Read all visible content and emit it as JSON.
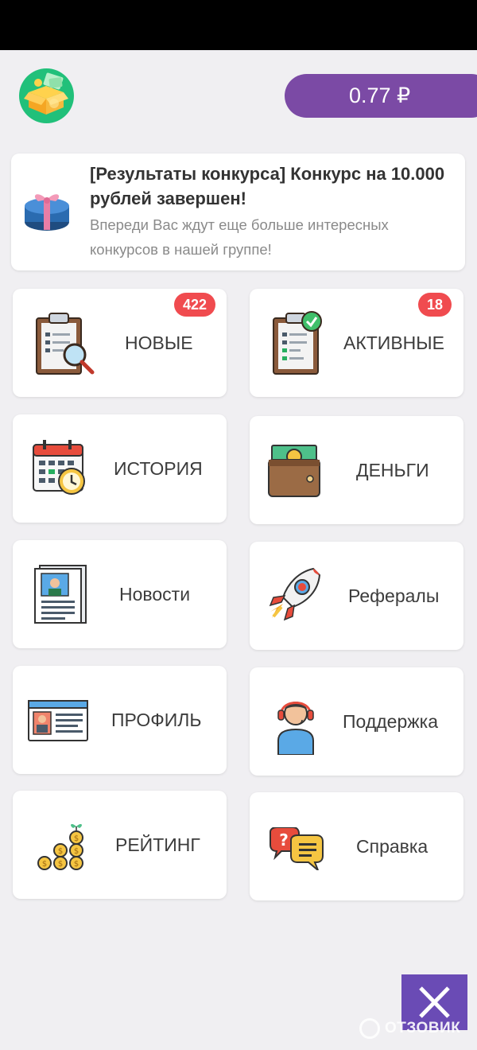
{
  "header": {
    "balance": "0.77 ₽"
  },
  "news": {
    "title": "[Результаты конкурса] Конкурс на 10.000 рублей завершен!",
    "description": "Впереди Вас ждут еще больше интересных конкурсов в нашей группе!"
  },
  "tiles": [
    {
      "label": "НОВЫЕ",
      "badge": "422",
      "icon": "clipboard-search-icon"
    },
    {
      "label": "АКТИВНЫЕ",
      "badge": "18",
      "icon": "clipboard-check-icon"
    },
    {
      "label": "ИСТОРИЯ",
      "icon": "calendar-clock-icon"
    },
    {
      "label": "ДЕНЬГИ",
      "icon": "wallet-icon"
    },
    {
      "label": "Новости",
      "icon": "newspaper-icon"
    },
    {
      "label": "Рефералы",
      "icon": "rocket-icon"
    },
    {
      "label": "ПРОФИЛЬ",
      "icon": "profile-card-icon"
    },
    {
      "label": "Поддержка",
      "icon": "support-agent-icon"
    },
    {
      "label": "РЕЙТИНГ",
      "icon": "coin-stack-icon"
    },
    {
      "label": "Справка",
      "icon": "help-chat-icon"
    }
  ],
  "watermark": "ОТЗОВИК",
  "colors": {
    "accent": "#7b4aa5",
    "badge": "#f04b4f",
    "close_button": "#6a4bb5",
    "logo_bg": "#21c07a"
  }
}
